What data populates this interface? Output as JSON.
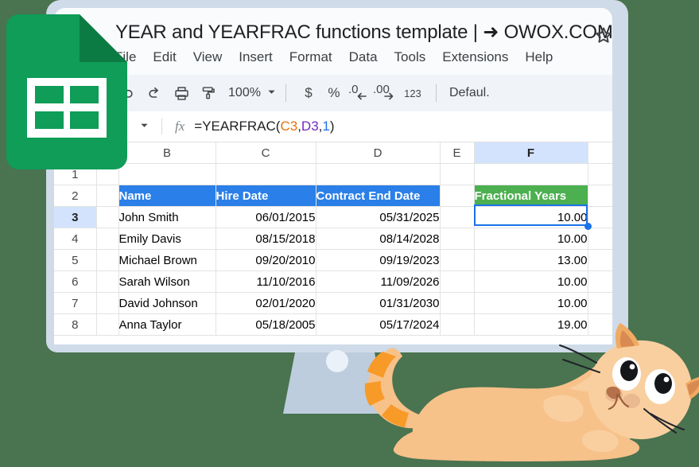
{
  "theme": {
    "background": "#4a7350",
    "monitor_frame": "#cfdbe8",
    "monitor_stand": "#bdcddd",
    "toolbar_bg": "#f0f4f9",
    "titlebar_bg": "#f9fbfd",
    "accent_blue": "#1a73e8",
    "header_blue": "#2a7fe8",
    "header_green": "#4cb050",
    "sheets_green": "#0f9d58",
    "sheets_green_dark": "#0c7b43",
    "cat_body": "#f7c18a",
    "cat_stripe": "#f79a28"
  },
  "app": {
    "title": "YEAR and YEARFRAC functions template | ➜ OWOX.COM",
    "star_icon": "star-icon",
    "menus": [
      "File",
      "Edit",
      "View",
      "Insert",
      "Format",
      "Data",
      "Tools",
      "Extensions",
      "Help"
    ]
  },
  "toolbar": {
    "menus_label": "Menus",
    "undo_icon": "undo-icon",
    "redo_icon": "redo-icon",
    "print_icon": "print-icon",
    "paint_format_icon": "paint-format-icon",
    "zoom_value": "100%",
    "zoom_caret_icon": "chevron-down-icon",
    "currency_label": "$",
    "percent_label": "%",
    "decrease_decimal_label": ".0",
    "increase_decimal_label": ".00",
    "more_formats_label": "123",
    "font_label": "Defaul."
  },
  "formula_bar": {
    "namebox_caret_icon": "chevron-down-icon",
    "fx_icon": "fx-icon",
    "formula_prefix": "=YEARFRAC(",
    "ref1": "C3",
    "comma1": ",",
    "ref2": "D3",
    "comma2": ",",
    "arg3": "1",
    "formula_suffix": ")",
    "formula_full": "=YEARFRAC(C3,D3,1)"
  },
  "sheet": {
    "column_headers": [
      "B",
      "C",
      "D",
      "E",
      "F"
    ],
    "selected_column": "F",
    "selected_row": "3",
    "selected_cell": "F3",
    "row_numbers": [
      "1",
      "2",
      "3",
      "4",
      "5",
      "6",
      "7",
      "8"
    ],
    "table_headers": {
      "name": "Name",
      "hire_date": "Hire Date",
      "contract_end_date": "Contract End Date",
      "fractional_years": "Fractional Years"
    },
    "rows": [
      {
        "row": "3",
        "name": "John Smith",
        "hire_date": "06/01/2015",
        "end_date": "05/31/2025",
        "years": "10.00"
      },
      {
        "row": "4",
        "name": "Emily Davis",
        "hire_date": "08/15/2018",
        "end_date": "08/14/2028",
        "years": "10.00"
      },
      {
        "row": "5",
        "name": "Michael Brown",
        "hire_date": "09/20/2010",
        "end_date": "09/19/2023",
        "years": "13.00"
      },
      {
        "row": "6",
        "name": "Sarah Wilson",
        "hire_date": "11/10/2016",
        "end_date": "11/09/2026",
        "years": "10.00"
      },
      {
        "row": "7",
        "name": "David Johnson",
        "hire_date": "02/01/2020",
        "end_date": "01/31/2030",
        "years": "10.00"
      },
      {
        "row": "8",
        "name": "Anna Taylor",
        "hire_date": "05/18/2005",
        "end_date": "05/17/2024",
        "years": "19.00"
      }
    ]
  },
  "decor": {
    "sheets_logo_icon": "google-sheets-logo-icon",
    "cat_illustration": "cat-illustration",
    "monitor_camera": "monitor-camera-dot"
  }
}
